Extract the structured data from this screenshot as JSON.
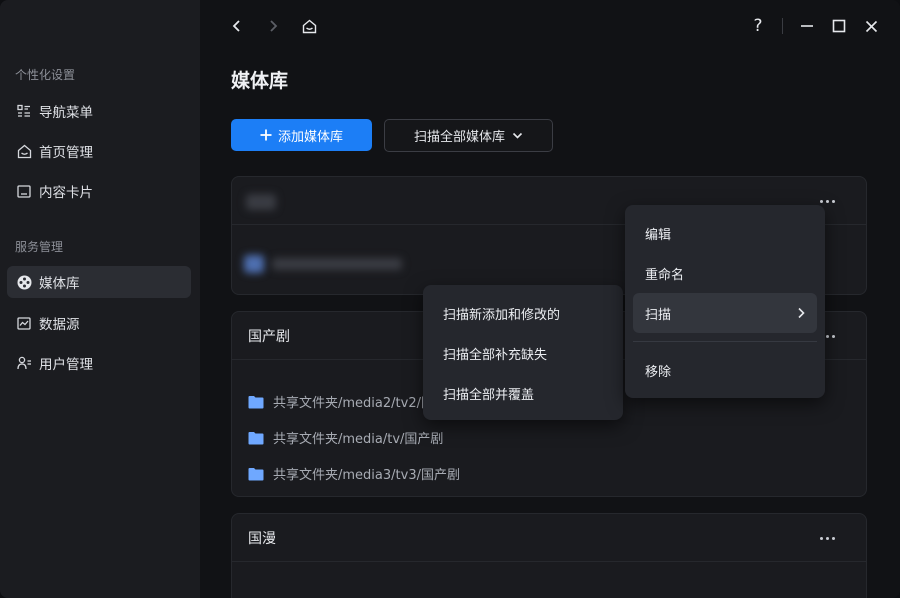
{
  "sidebar": {
    "section1": "个性化设置",
    "section2": "服务管理",
    "items": [
      {
        "label": "导航菜单",
        "icon": "list-icon"
      },
      {
        "label": "首页管理",
        "icon": "home-icon"
      },
      {
        "label": "内容卡片",
        "icon": "card-icon"
      },
      {
        "label": "媒体库",
        "icon": "media-library-icon",
        "active": true
      },
      {
        "label": "数据源",
        "icon": "chart-icon"
      },
      {
        "label": "用户管理",
        "icon": "users-icon"
      }
    ]
  },
  "titlebar": {
    "back_icon": "chevron-left-icon",
    "forward_icon": "chevron-right-icon",
    "home_icon": "home-icon",
    "help_label": "?",
    "minimize_icon": "minimize-icon",
    "maximize_icon": "maximize-icon",
    "close_icon": "close-icon"
  },
  "page": {
    "title": "媒体库",
    "add_button": "添加媒体库",
    "scan_all_button": "扫描全部媒体库"
  },
  "cards": [
    {
      "title": "",
      "blurred": true
    },
    {
      "title": "国产剧",
      "folders": [
        "共享文件夹/media2/tv2/国产剧",
        "共享文件夹/media/tv/国产剧",
        "共享文件夹/media3/tv3/国产剧"
      ]
    },
    {
      "title": "国漫"
    }
  ],
  "context_menu": {
    "items": [
      "编辑",
      "重命名",
      "扫描",
      "移除"
    ],
    "hovered": "扫描"
  },
  "submenu": {
    "items": [
      "扫描新添加和修改的",
      "扫描全部补充缺失",
      "扫描全部并覆盖"
    ]
  },
  "colors": {
    "accent": "#1c7ef6",
    "folder": "#6fa8ff"
  }
}
